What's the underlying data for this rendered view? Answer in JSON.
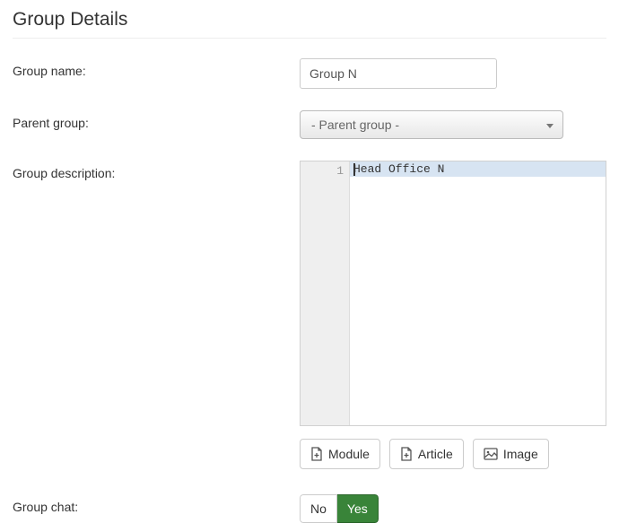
{
  "title": "Group Details",
  "labels": {
    "group_name": "Group name:",
    "parent_group": "Parent group:",
    "group_description": "Group description:",
    "group_chat": "Group chat:"
  },
  "fields": {
    "group_name_value": "Group N",
    "parent_group_selected": "- Parent group -"
  },
  "editor": {
    "line_number": "1",
    "line_text": "Head Office N"
  },
  "buttons": {
    "module": "Module",
    "article": "Article",
    "image": "Image"
  },
  "chat": {
    "no": "No",
    "yes": "Yes"
  }
}
